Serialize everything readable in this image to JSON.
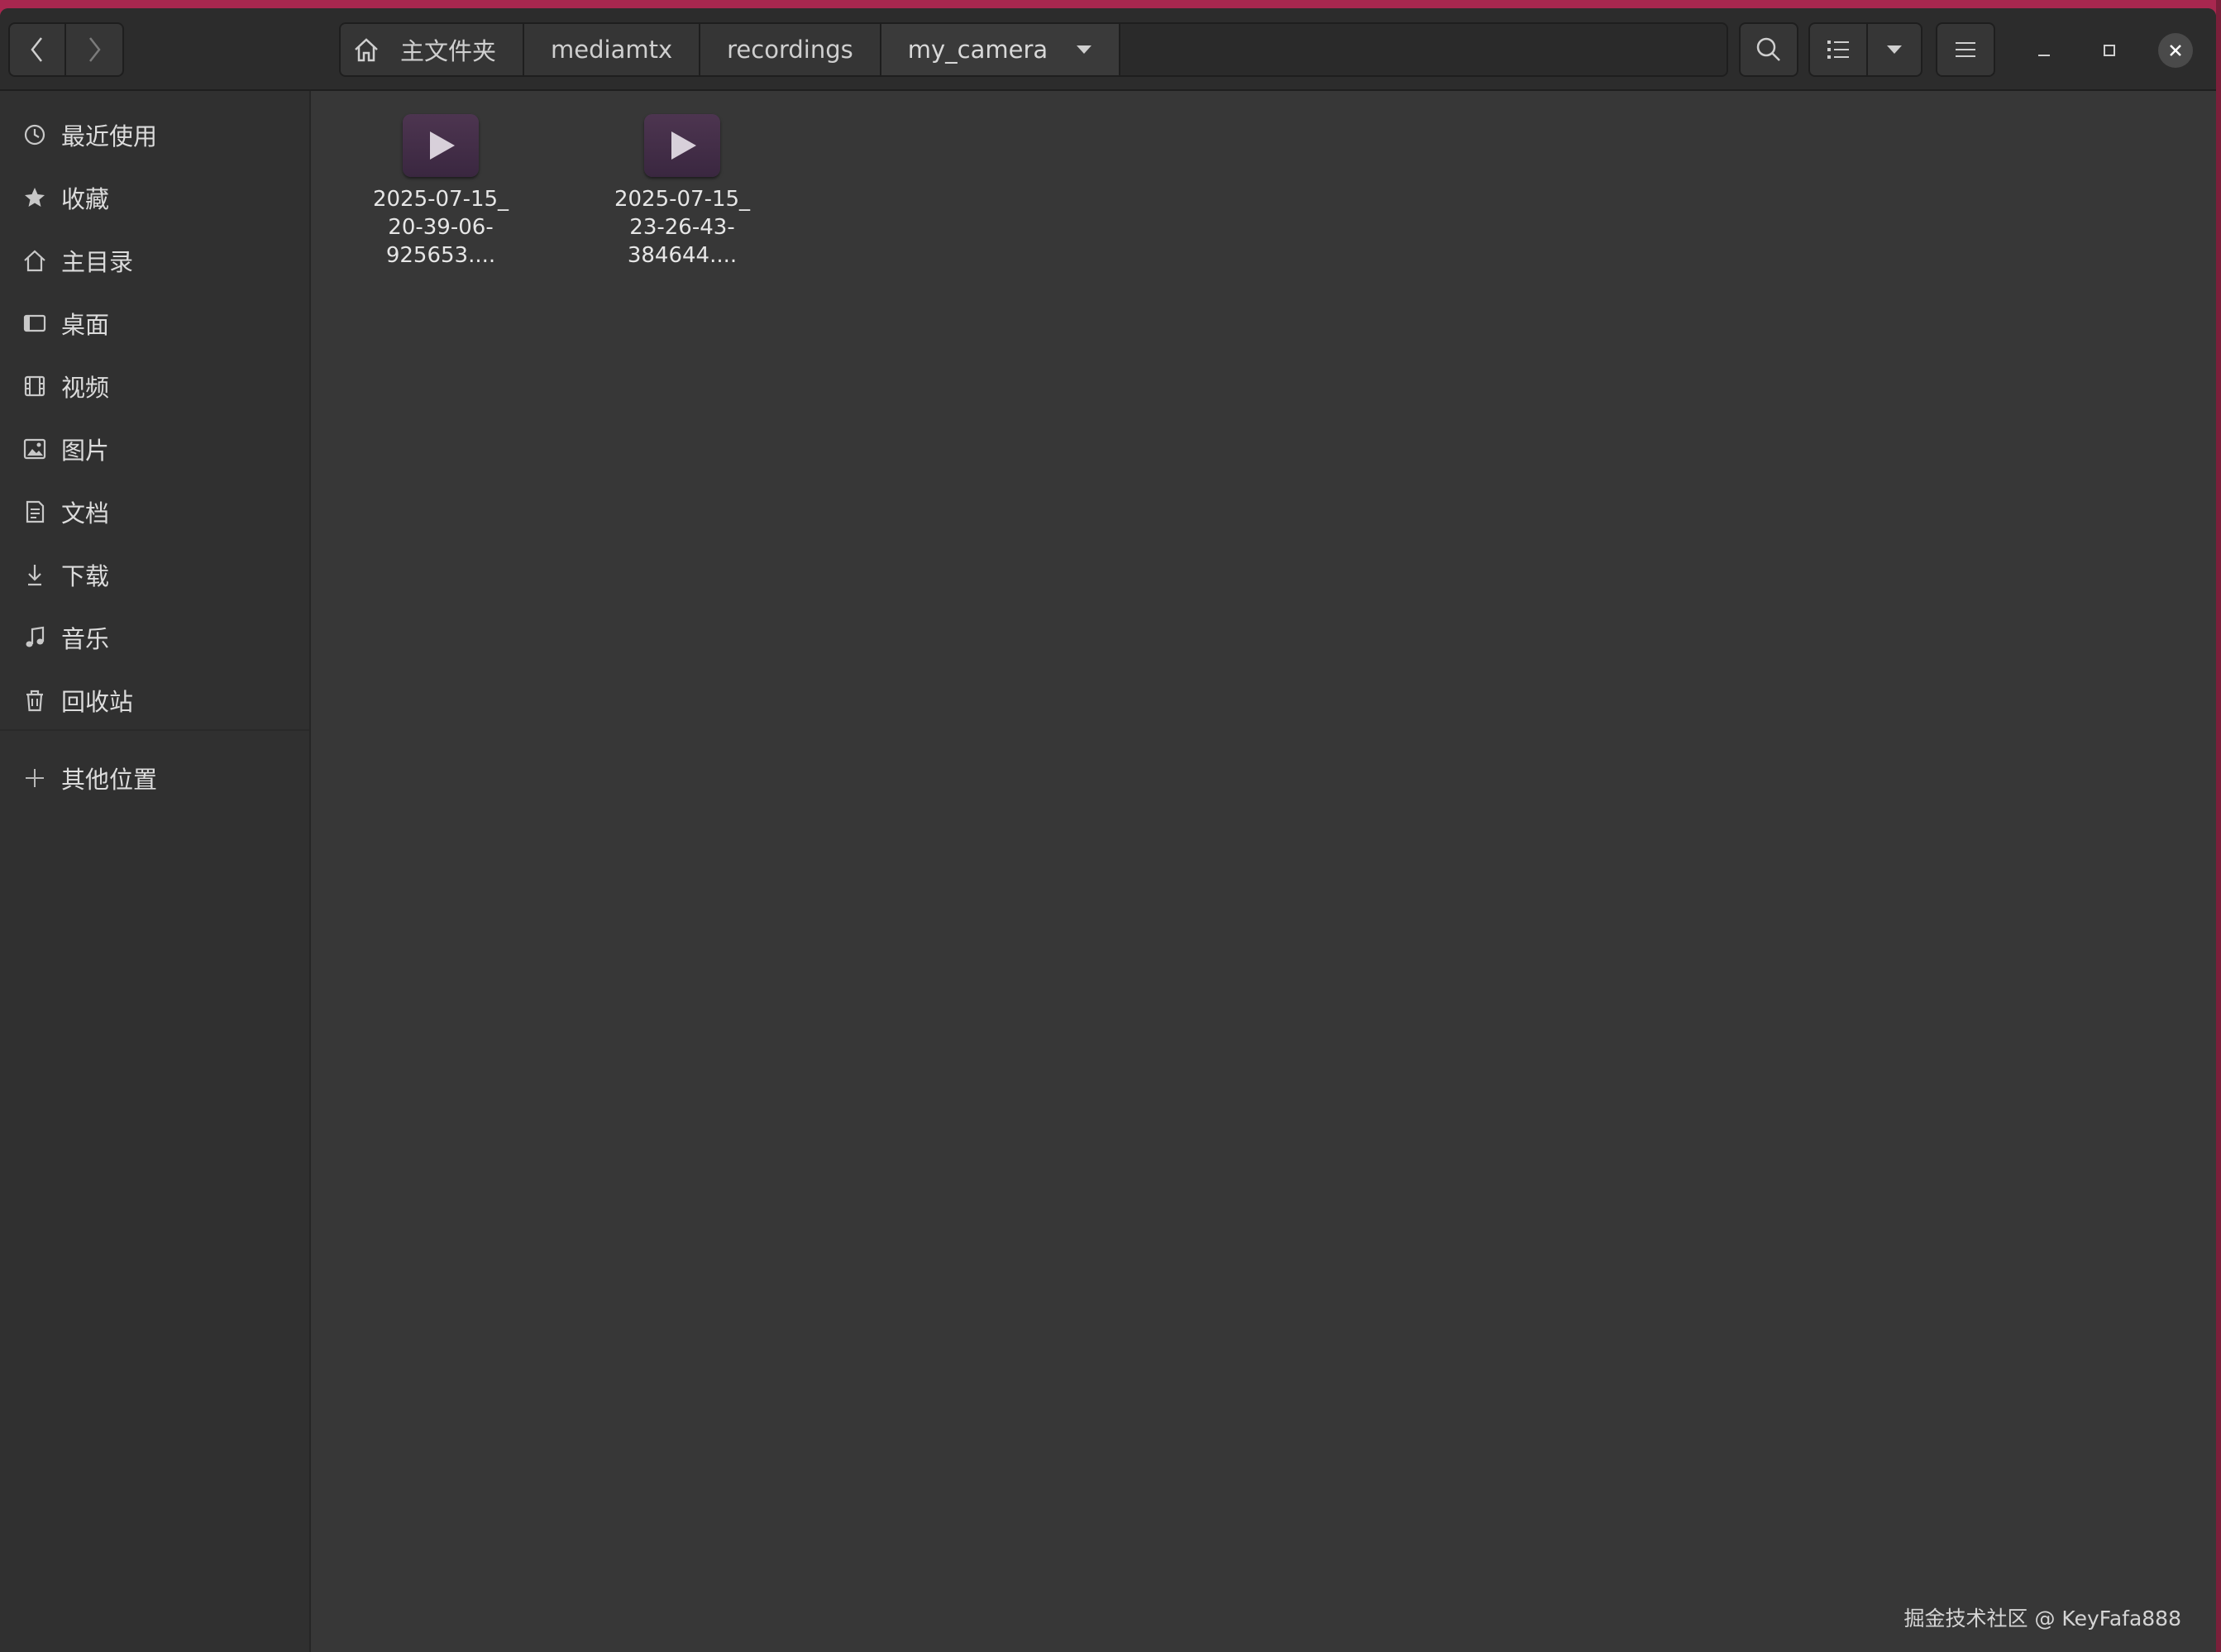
{
  "colors": {
    "desktop_accent": "#a8274f",
    "window_bg": "#373737",
    "sidebar_bg": "#303030",
    "headerbar_bg": "#2c2c2c",
    "video_icon": "#4d3550"
  },
  "pathbar": {
    "home_icon": "home-icon",
    "crumbs": [
      "主文件夹",
      "mediamtx",
      "recordings",
      "my_camera"
    ]
  },
  "toolbar": {
    "back_icon": "chevron-left-icon",
    "forward_icon": "chevron-right-icon",
    "search_icon": "search-icon",
    "view_icon": "list-view-icon",
    "view_menu_icon": "caret-down-icon",
    "main_menu_icon": "hamburger-menu-icon"
  },
  "window_controls": [
    "minimize-icon",
    "maximize-icon",
    "close-icon"
  ],
  "sidebar": {
    "items": [
      {
        "label": "最近使用",
        "icon": "clock-icon"
      },
      {
        "label": "收藏",
        "icon": "star-icon"
      },
      {
        "label": "主目录",
        "icon": "home-icon"
      },
      {
        "label": "桌面",
        "icon": "desktop-icon"
      },
      {
        "label": "视频",
        "icon": "film-icon"
      },
      {
        "label": "图片",
        "icon": "picture-icon"
      },
      {
        "label": "文档",
        "icon": "document-icon"
      },
      {
        "label": "下载",
        "icon": "download-icon"
      },
      {
        "label": "音乐",
        "icon": "music-icon"
      },
      {
        "label": "回收站",
        "icon": "trash-icon"
      }
    ],
    "other": {
      "label": "其他位置",
      "icon": "plus-icon"
    }
  },
  "files": [
    {
      "name_lines": [
        "2025-07-15_",
        "20-39-06-",
        "925653...."
      ],
      "icon": "video-file-icon"
    },
    {
      "name_lines": [
        "2025-07-15_",
        "23-26-43-",
        "384644...."
      ],
      "icon": "video-file-icon"
    }
  ],
  "watermark": "掘金技术社区 @ KeyFafa888"
}
